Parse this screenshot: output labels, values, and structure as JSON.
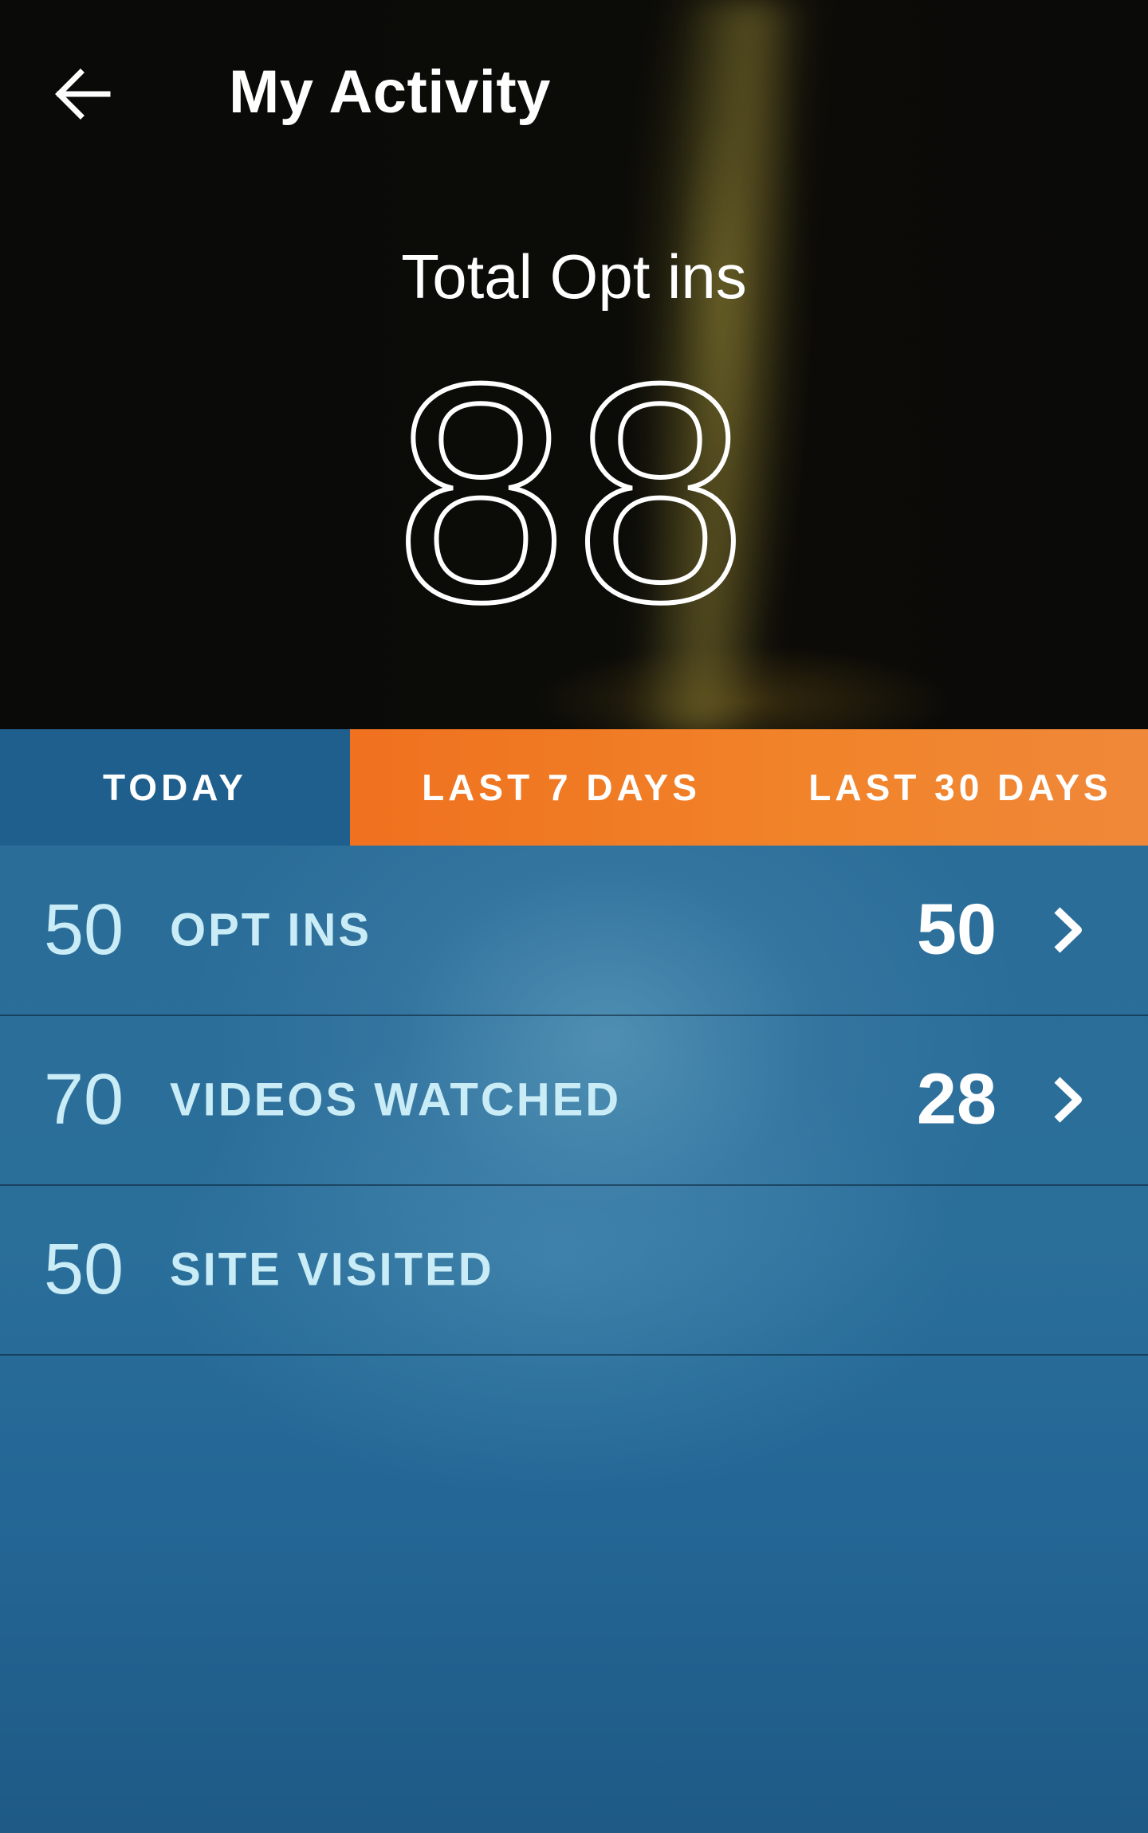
{
  "header": {
    "title": "My Activity",
    "back_icon": "arrow-left-icon"
  },
  "hero": {
    "label": "Total Opt ins",
    "value": "88"
  },
  "tabs": [
    {
      "label": "TODAY",
      "selected": true
    },
    {
      "label": "LAST 7 DAYS",
      "selected": false
    },
    {
      "label": "LAST 30 DAYS",
      "selected": false
    }
  ],
  "stats": [
    {
      "goal": "50",
      "label": "OPT INS",
      "value": "50",
      "icon": "chevron-right-icon"
    },
    {
      "goal": "70",
      "label": "VIDEOS WATCHED",
      "value": "28",
      "icon": "chevron-right-icon"
    },
    {
      "goal": "50",
      "label": "SITE VISITED"
    }
  ],
  "colors": {
    "accent_orange": "#f0711f",
    "tab_selected_blue": "#1f5f8e",
    "stat_text": "#c9ecf6"
  }
}
